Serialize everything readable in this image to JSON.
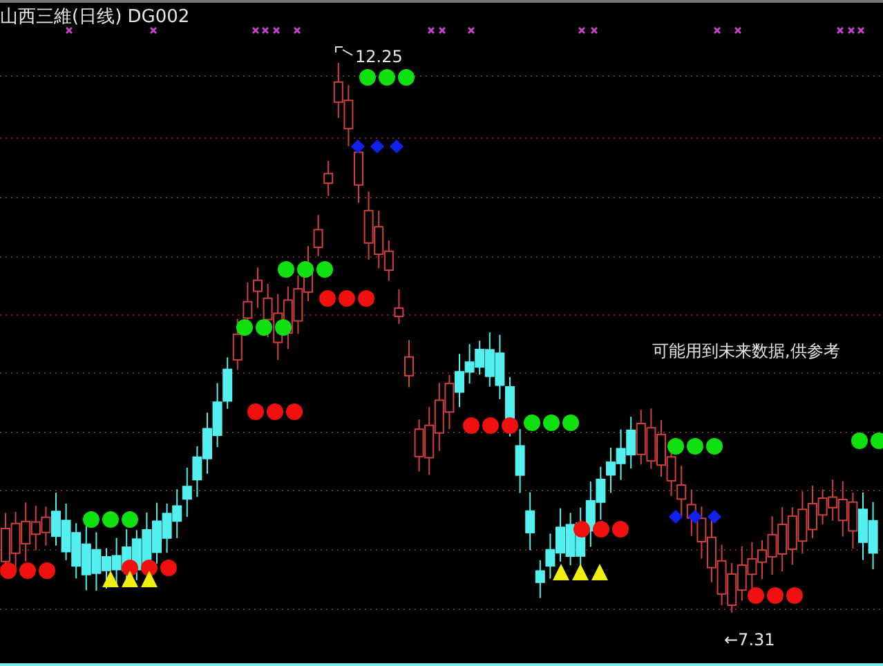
{
  "chart": {
    "title": "山西三維(日线) DG002",
    "high_label": "12.25",
    "low_label": "←7.31",
    "notice": "可能用到未来数据,供参考"
  }
}
